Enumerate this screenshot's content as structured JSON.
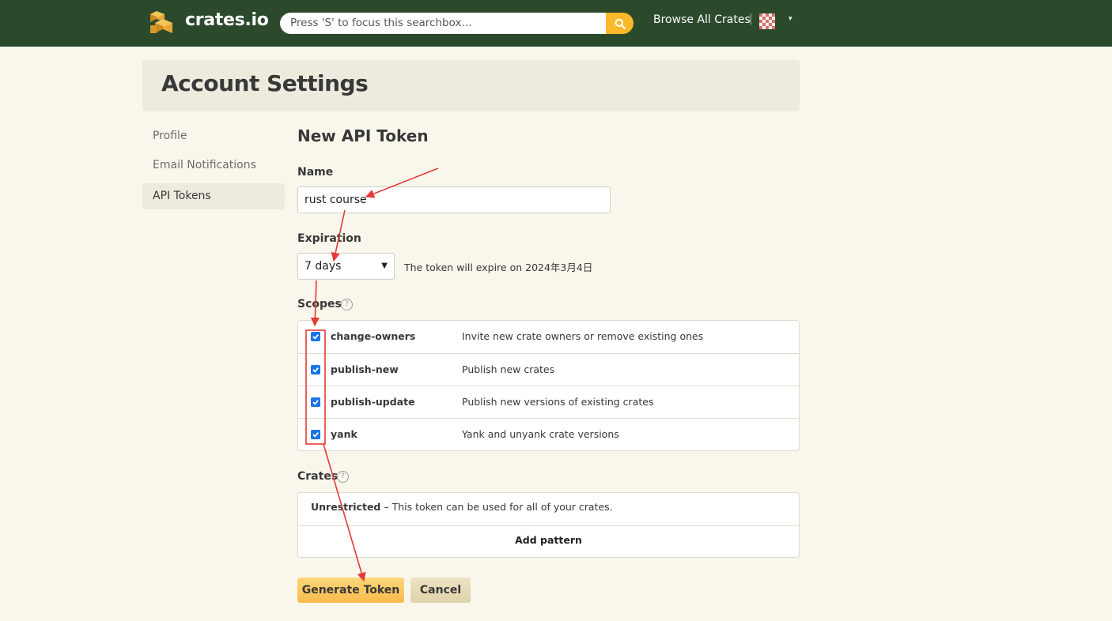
{
  "nav": {
    "brand": "crates.io",
    "search_placeholder": "Press 'S' to focus this searchbox…",
    "browse_label": "Browse All Crates",
    "separator": "|",
    "menu_caret": "▾"
  },
  "page": {
    "title": "Account Settings"
  },
  "sidebar": {
    "items": [
      {
        "label": "Profile"
      },
      {
        "label": "Email Notifications"
      },
      {
        "label": "API Tokens"
      }
    ]
  },
  "form": {
    "title": "New API Token",
    "name_label": "Name",
    "name_value": "rust course",
    "expiration_label": "Expiration",
    "expiration_value": "7 days",
    "expiration_note": "The token will expire on 2024年3月4日",
    "scopes_label": "Scopes",
    "scopes": [
      {
        "name": "change-owners",
        "description": "Invite new crate owners or remove existing ones",
        "checked": true
      },
      {
        "name": "publish-new",
        "description": "Publish new crates",
        "checked": true
      },
      {
        "name": "publish-update",
        "description": "Publish new versions of existing crates",
        "checked": true
      },
      {
        "name": "yank",
        "description": "Yank and unyank crate versions",
        "checked": true
      }
    ],
    "crates_label": "Crates",
    "crates_unrestricted": "Unrestricted",
    "crates_unrestricted_desc": " – This token can be used for all of your crates.",
    "add_pattern_label": "Add pattern",
    "generate_label": "Generate Token",
    "cancel_label": "Cancel"
  },
  "colors": {
    "nav_bg": "#2b4a2c",
    "page_bg": "#f9f7ec",
    "accent": "#f9b92b",
    "annotation": "#e53935",
    "checkbox": "#1a73e8"
  }
}
